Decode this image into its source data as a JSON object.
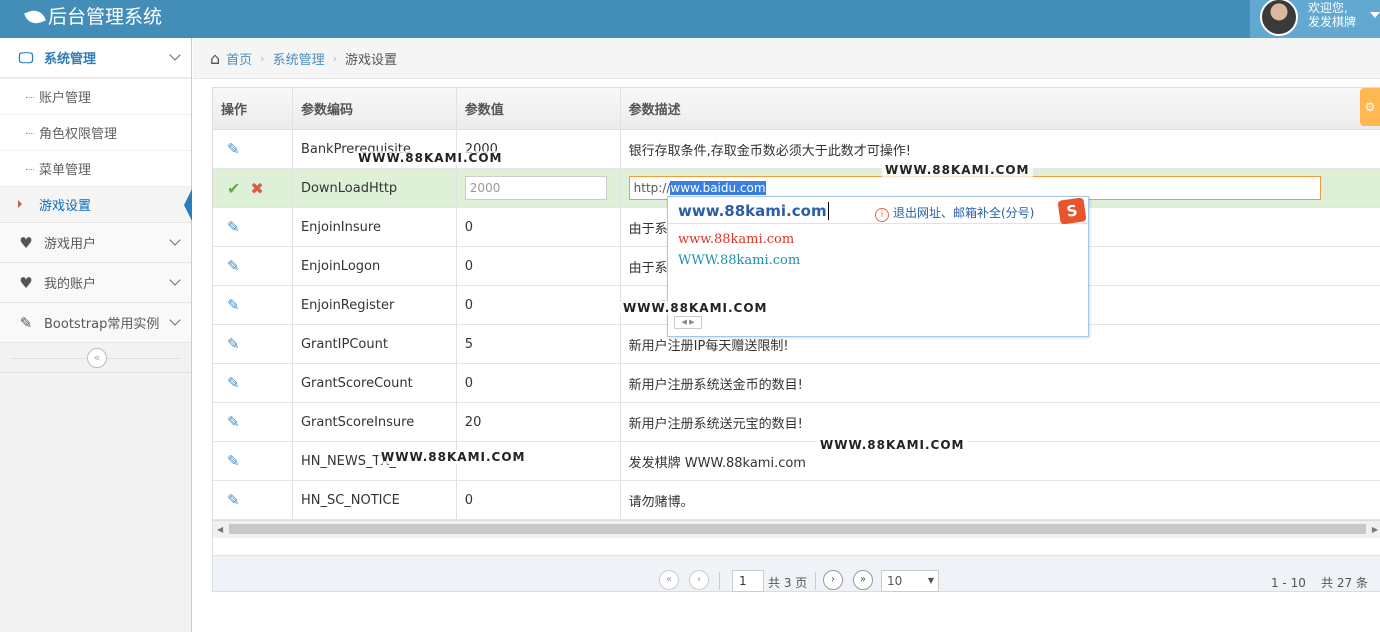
{
  "header": {
    "title": "后台管理系统",
    "welcome_line1": "欢迎您,",
    "welcome_line2": "发发棋牌"
  },
  "sidebar": {
    "items": [
      {
        "label": "系统管理",
        "icon": "desktop-icon"
      },
      {
        "label": "游戏用户",
        "icon": "heart-icon"
      },
      {
        "label": "我的账户",
        "icon": "heart-icon"
      },
      {
        "label": "Bootstrap常用实例",
        "icon": "edit-icon"
      }
    ],
    "submenu": [
      "账户管理",
      "角色权限管理",
      "菜单管理",
      "游戏设置"
    ],
    "active_sub": "游戏设置"
  },
  "breadcrumb": {
    "home": "首页",
    "parent": "系统管理",
    "current": "游戏设置"
  },
  "grid": {
    "headers": [
      "操作",
      "参数编码",
      "参数值",
      "参数描述"
    ],
    "rows": [
      {
        "code": "BankPrerequisite",
        "value": "2000",
        "desc": "银行存取条件,存取金币数必须大于此数才可操作!"
      },
      {
        "code": "DownLoadHttp",
        "value": "2000",
        "desc": "http://www.baidu.com",
        "editing": true
      },
      {
        "code": "EnjoinInsure",
        "value": "0",
        "desc": "由于系"
      },
      {
        "code": "EnjoinLogon",
        "value": "0",
        "desc": "由于系"
      },
      {
        "code": "EnjoinRegister",
        "value": "0",
        "desc": "由于系"
      },
      {
        "code": "GrantIPCount",
        "value": "5",
        "desc": "新用户注册IP每天赠送限制!"
      },
      {
        "code": "GrantScoreCount",
        "value": "0",
        "desc": "新用户注册系统送金币的数目!"
      },
      {
        "code": "GrantScoreInsure",
        "value": "20",
        "desc": "新用户注册系统送元宝的数目!"
      },
      {
        "code": "HN_NEWS_TX_",
        "value": "",
        "desc": "发发棋牌 WWW.88kami.com"
      },
      {
        "code": "HN_SC_NOTICE",
        "value": "0",
        "desc": "请勿赌博。"
      }
    ],
    "edit_url_prefix": "http://",
    "edit_url_selected": "www.baidu.com"
  },
  "pager": {
    "page": "1",
    "total_pages_text": "共 3 页",
    "page_size": "10",
    "info": "1 - 10    共 27 条"
  },
  "ime": {
    "typed": "www.88kami.com",
    "tip": "退出网址、邮箱补全(分号)",
    "candidates": [
      "www.88kami.com",
      "WWW.88kami.com"
    ],
    "candidate_colors": [
      "#d9362b",
      "#1f8fb0"
    ]
  },
  "watermarks": [
    "WWW.88KAMI.COM",
    "WWW.88KAMI.COM",
    "WWW.88KAMI.COM",
    "WWW.88KAMI.COM",
    "WWW.88KAMI.COM"
  ]
}
